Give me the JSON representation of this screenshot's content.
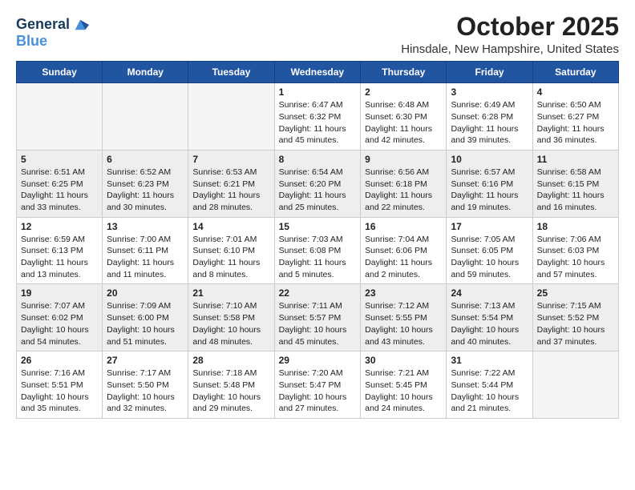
{
  "header": {
    "logo_line1": "General",
    "logo_line2": "Blue",
    "month": "October 2025",
    "location": "Hinsdale, New Hampshire, United States"
  },
  "days_of_week": [
    "Sunday",
    "Monday",
    "Tuesday",
    "Wednesday",
    "Thursday",
    "Friday",
    "Saturday"
  ],
  "weeks": [
    [
      {
        "day": "",
        "info": ""
      },
      {
        "day": "",
        "info": ""
      },
      {
        "day": "",
        "info": ""
      },
      {
        "day": "1",
        "info": "Sunrise: 6:47 AM\nSunset: 6:32 PM\nDaylight: 11 hours\nand 45 minutes."
      },
      {
        "day": "2",
        "info": "Sunrise: 6:48 AM\nSunset: 6:30 PM\nDaylight: 11 hours\nand 42 minutes."
      },
      {
        "day": "3",
        "info": "Sunrise: 6:49 AM\nSunset: 6:28 PM\nDaylight: 11 hours\nand 39 minutes."
      },
      {
        "day": "4",
        "info": "Sunrise: 6:50 AM\nSunset: 6:27 PM\nDaylight: 11 hours\nand 36 minutes."
      }
    ],
    [
      {
        "day": "5",
        "info": "Sunrise: 6:51 AM\nSunset: 6:25 PM\nDaylight: 11 hours\nand 33 minutes."
      },
      {
        "day": "6",
        "info": "Sunrise: 6:52 AM\nSunset: 6:23 PM\nDaylight: 11 hours\nand 30 minutes."
      },
      {
        "day": "7",
        "info": "Sunrise: 6:53 AM\nSunset: 6:21 PM\nDaylight: 11 hours\nand 28 minutes."
      },
      {
        "day": "8",
        "info": "Sunrise: 6:54 AM\nSunset: 6:20 PM\nDaylight: 11 hours\nand 25 minutes."
      },
      {
        "day": "9",
        "info": "Sunrise: 6:56 AM\nSunset: 6:18 PM\nDaylight: 11 hours\nand 22 minutes."
      },
      {
        "day": "10",
        "info": "Sunrise: 6:57 AM\nSunset: 6:16 PM\nDaylight: 11 hours\nand 19 minutes."
      },
      {
        "day": "11",
        "info": "Sunrise: 6:58 AM\nSunset: 6:15 PM\nDaylight: 11 hours\nand 16 minutes."
      }
    ],
    [
      {
        "day": "12",
        "info": "Sunrise: 6:59 AM\nSunset: 6:13 PM\nDaylight: 11 hours\nand 13 minutes."
      },
      {
        "day": "13",
        "info": "Sunrise: 7:00 AM\nSunset: 6:11 PM\nDaylight: 11 hours\nand 11 minutes."
      },
      {
        "day": "14",
        "info": "Sunrise: 7:01 AM\nSunset: 6:10 PM\nDaylight: 11 hours\nand 8 minutes."
      },
      {
        "day": "15",
        "info": "Sunrise: 7:03 AM\nSunset: 6:08 PM\nDaylight: 11 hours\nand 5 minutes."
      },
      {
        "day": "16",
        "info": "Sunrise: 7:04 AM\nSunset: 6:06 PM\nDaylight: 11 hours\nand 2 minutes."
      },
      {
        "day": "17",
        "info": "Sunrise: 7:05 AM\nSunset: 6:05 PM\nDaylight: 10 hours\nand 59 minutes."
      },
      {
        "day": "18",
        "info": "Sunrise: 7:06 AM\nSunset: 6:03 PM\nDaylight: 10 hours\nand 57 minutes."
      }
    ],
    [
      {
        "day": "19",
        "info": "Sunrise: 7:07 AM\nSunset: 6:02 PM\nDaylight: 10 hours\nand 54 minutes."
      },
      {
        "day": "20",
        "info": "Sunrise: 7:09 AM\nSunset: 6:00 PM\nDaylight: 10 hours\nand 51 minutes."
      },
      {
        "day": "21",
        "info": "Sunrise: 7:10 AM\nSunset: 5:58 PM\nDaylight: 10 hours\nand 48 minutes."
      },
      {
        "day": "22",
        "info": "Sunrise: 7:11 AM\nSunset: 5:57 PM\nDaylight: 10 hours\nand 45 minutes."
      },
      {
        "day": "23",
        "info": "Sunrise: 7:12 AM\nSunset: 5:55 PM\nDaylight: 10 hours\nand 43 minutes."
      },
      {
        "day": "24",
        "info": "Sunrise: 7:13 AM\nSunset: 5:54 PM\nDaylight: 10 hours\nand 40 minutes."
      },
      {
        "day": "25",
        "info": "Sunrise: 7:15 AM\nSunset: 5:52 PM\nDaylight: 10 hours\nand 37 minutes."
      }
    ],
    [
      {
        "day": "26",
        "info": "Sunrise: 7:16 AM\nSunset: 5:51 PM\nDaylight: 10 hours\nand 35 minutes."
      },
      {
        "day": "27",
        "info": "Sunrise: 7:17 AM\nSunset: 5:50 PM\nDaylight: 10 hours\nand 32 minutes."
      },
      {
        "day": "28",
        "info": "Sunrise: 7:18 AM\nSunset: 5:48 PM\nDaylight: 10 hours\nand 29 minutes."
      },
      {
        "day": "29",
        "info": "Sunrise: 7:20 AM\nSunset: 5:47 PM\nDaylight: 10 hours\nand 27 minutes."
      },
      {
        "day": "30",
        "info": "Sunrise: 7:21 AM\nSunset: 5:45 PM\nDaylight: 10 hours\nand 24 minutes."
      },
      {
        "day": "31",
        "info": "Sunrise: 7:22 AM\nSunset: 5:44 PM\nDaylight: 10 hours\nand 21 minutes."
      },
      {
        "day": "",
        "info": ""
      }
    ]
  ],
  "shaded_rows": [
    1,
    3
  ]
}
